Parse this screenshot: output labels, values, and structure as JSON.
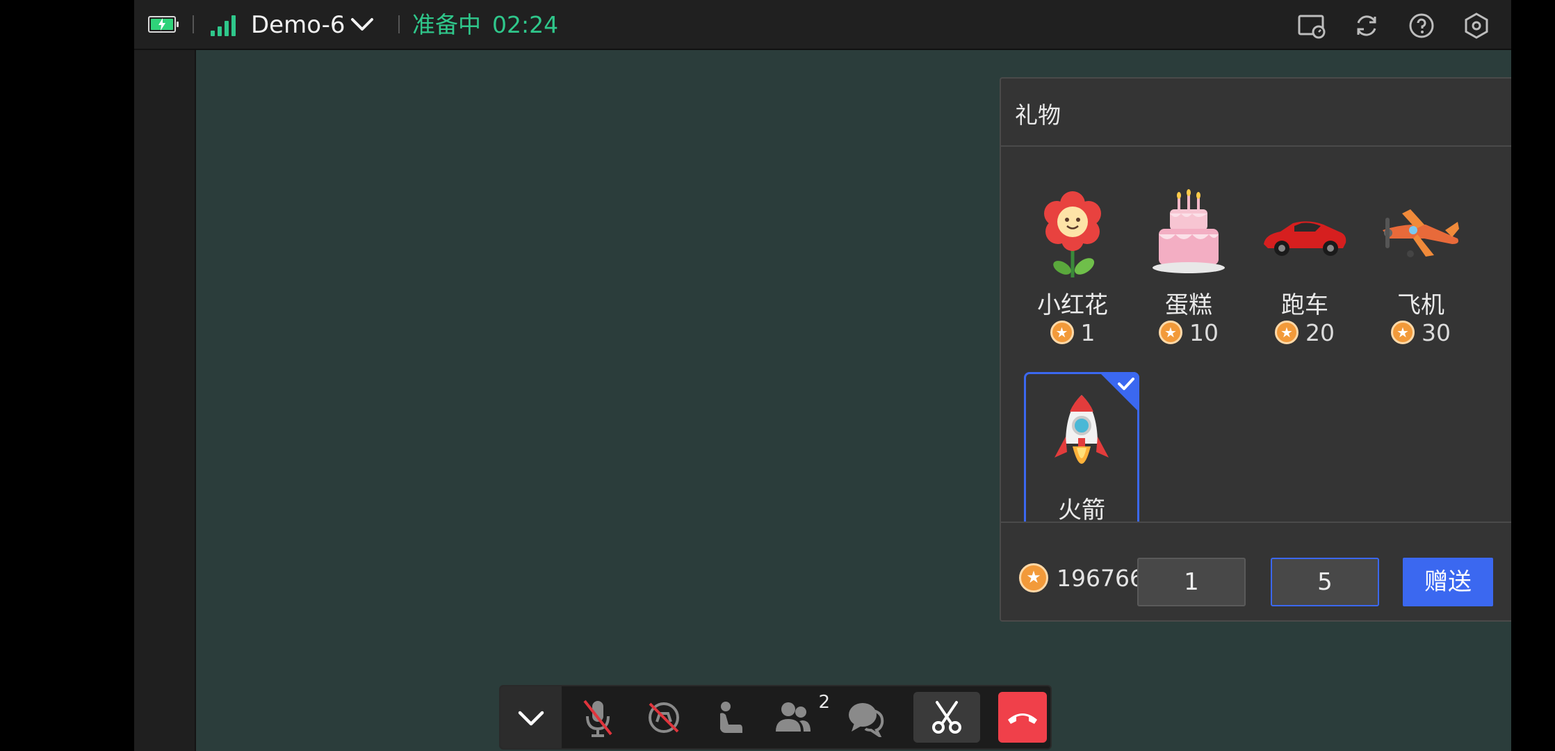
{
  "topbar": {
    "device_name": "Demo-6",
    "status_text": "准备中",
    "elapsed_time": "02:24",
    "icons": [
      "battery-icon",
      "signal-icon",
      "chevron-down-icon",
      "screen-cast-icon",
      "refresh-icon",
      "help-icon",
      "settings-icon"
    ],
    "status_color": "#2fc78b"
  },
  "gift_panel": {
    "title": "礼物",
    "items": [
      {
        "name": "小红花",
        "price": "1"
      },
      {
        "name": "蛋糕",
        "price": "10"
      },
      {
        "name": "跑车",
        "price": "20"
      },
      {
        "name": "飞机",
        "price": "30"
      },
      {
        "name": "火箭",
        "price": "",
        "selected": true
      }
    ],
    "balance": "196766",
    "quantity_left": "1",
    "quantity_right": "5",
    "send_label": "赠送",
    "accent_color": "#3b68f0"
  },
  "toolbar": {
    "buttons": [
      "collapse-icon",
      "mic-off-icon",
      "speaker-off-icon",
      "seat-icon",
      "members-icon",
      "chat-icon",
      "scissors-icon",
      "hang-up-icon"
    ],
    "member_count": "2",
    "hangup_color": "#f0404a"
  }
}
